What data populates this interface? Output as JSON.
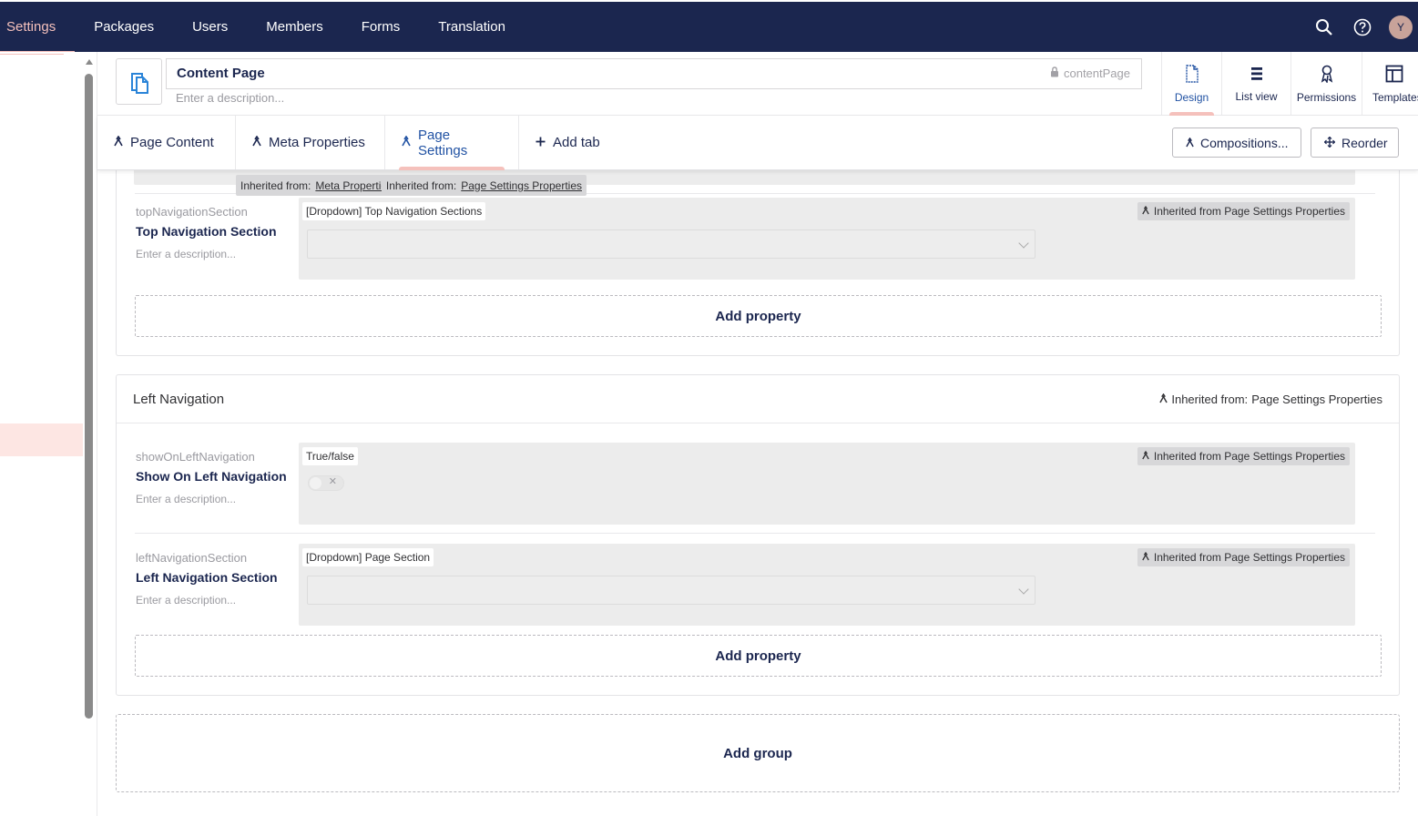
{
  "topnav": {
    "sections": [
      {
        "label": "Settings",
        "active": true
      },
      {
        "label": "Packages"
      },
      {
        "label": "Users"
      },
      {
        "label": "Members"
      },
      {
        "label": "Forms"
      },
      {
        "label": "Translation"
      }
    ],
    "avatar_initial": "Y",
    "background_color": "#1b264f",
    "accent_color": "#f5c1bc"
  },
  "header": {
    "name": "Content Page",
    "alias": "contentPage",
    "description_placeholder": "Enter a description...",
    "apps": [
      {
        "label": "Design",
        "icon": "document-outline-icon",
        "active": true
      },
      {
        "label": "List view",
        "icon": "list-icon"
      },
      {
        "label": "Permissions",
        "icon": "ribbon-icon"
      },
      {
        "label": "Templates",
        "icon": "layout-icon"
      }
    ]
  },
  "tabs": {
    "items": [
      {
        "label": "Page Content",
        "icon": "inherited-icon"
      },
      {
        "label": "Meta Properties",
        "icon": "inherited-icon"
      },
      {
        "label": "Page Settings",
        "icon": "inherited-icon",
        "active": true
      }
    ],
    "add_tab": "Add tab",
    "compositions": "Compositions...",
    "reorder": "Reorder"
  },
  "tooltip": {
    "prefix1": "Inherited from:",
    "link1": "Meta Properties",
    "prefix2": "Inherited from:",
    "link2": "Page Settings Properties"
  },
  "group_top": {
    "properties": [
      {
        "alias": "topNavigationSection",
        "label": "Top Navigation Section",
        "description": "Enter a description...",
        "editor": "[Dropdown] Top Navigation Sections",
        "inherited": "Inherited from Page Settings Properties"
      }
    ],
    "add_property": "Add property"
  },
  "group_left": {
    "title": "Left Navigation",
    "inherited_prefix": "Inherited from:",
    "inherited_source": "Page Settings Properties",
    "properties": [
      {
        "alias": "showOnLeftNavigation",
        "label": "Show On Left Navigation",
        "description": "Enter a description...",
        "editor": "True/false",
        "inherited": "Inherited from Page Settings Properties"
      },
      {
        "alias": "leftNavigationSection",
        "label": "Left Navigation Section",
        "description": "Enter a description...",
        "editor": "[Dropdown] Page Section",
        "inherited": "Inherited from Page Settings Properties"
      }
    ],
    "add_property": "Add property"
  },
  "add_group": "Add group"
}
